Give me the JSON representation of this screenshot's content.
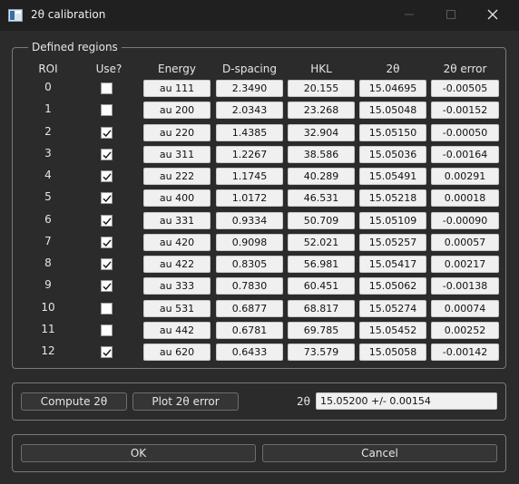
{
  "window": {
    "title": "2θ calibration",
    "colors": {
      "background": "#2b2b2b",
      "titlebar": "#202020",
      "cell_bg": "#f0f0f0"
    }
  },
  "regions": {
    "legend": "Defined regions",
    "headers": {
      "roi": "ROI",
      "use": "Use?",
      "energy": "Energy",
      "dspacing": "D-spacing",
      "hkl": "HKL",
      "two_theta": "2θ",
      "two_theta_error": "2θ error"
    },
    "rows": [
      {
        "roi": "0",
        "use": false,
        "energy": "au 111",
        "dspacing": "2.3490",
        "hkl": "20.155",
        "two_theta": "15.04695",
        "error": "-0.00505"
      },
      {
        "roi": "1",
        "use": false,
        "energy": "au 200",
        "dspacing": "2.0343",
        "hkl": "23.268",
        "two_theta": "15.05048",
        "error": "-0.00152"
      },
      {
        "roi": "2",
        "use": true,
        "energy": "au 220",
        "dspacing": "1.4385",
        "hkl": "32.904",
        "two_theta": "15.05150",
        "error": "-0.00050"
      },
      {
        "roi": "3",
        "use": true,
        "energy": "au 311",
        "dspacing": "1.2267",
        "hkl": "38.586",
        "two_theta": "15.05036",
        "error": "-0.00164"
      },
      {
        "roi": "4",
        "use": true,
        "energy": "au 222",
        "dspacing": "1.1745",
        "hkl": "40.289",
        "two_theta": "15.05491",
        "error": "0.00291"
      },
      {
        "roi": "5",
        "use": true,
        "energy": "au 400",
        "dspacing": "1.0172",
        "hkl": "46.531",
        "two_theta": "15.05218",
        "error": "0.00018"
      },
      {
        "roi": "6",
        "use": true,
        "energy": "au 331",
        "dspacing": "0.9334",
        "hkl": "50.709",
        "two_theta": "15.05109",
        "error": "-0.00090"
      },
      {
        "roi": "7",
        "use": true,
        "energy": "au 420",
        "dspacing": "0.9098",
        "hkl": "52.021",
        "two_theta": "15.05257",
        "error": "0.00057"
      },
      {
        "roi": "8",
        "use": true,
        "energy": "au 422",
        "dspacing": "0.8305",
        "hkl": "56.981",
        "two_theta": "15.05417",
        "error": "0.00217"
      },
      {
        "roi": "9",
        "use": true,
        "energy": "au 333",
        "dspacing": "0.7830",
        "hkl": "60.451",
        "two_theta": "15.05062",
        "error": "-0.00138"
      },
      {
        "roi": "10",
        "use": false,
        "energy": "au 531",
        "dspacing": "0.6877",
        "hkl": "68.817",
        "two_theta": "15.05274",
        "error": "0.00074"
      },
      {
        "roi": "11",
        "use": false,
        "energy": "au 442",
        "dspacing": "0.6781",
        "hkl": "69.785",
        "two_theta": "15.05452",
        "error": "0.00252"
      },
      {
        "roi": "12",
        "use": true,
        "energy": "au 620",
        "dspacing": "0.6433",
        "hkl": "73.579",
        "two_theta": "15.05058",
        "error": "-0.00142"
      }
    ]
  },
  "actions": {
    "compute_label": "Compute 2θ",
    "plot_label": "Plot 2θ error",
    "result_label": "2θ",
    "result_value": "15.05200 +/- 0.00154"
  },
  "footer": {
    "ok_label": "OK",
    "cancel_label": "Cancel"
  },
  "icons": {
    "app": "window-app-icon",
    "minimize": "minimize-icon",
    "maximize": "maximize-icon",
    "close": "close-icon",
    "check": "checkmark-icon"
  }
}
